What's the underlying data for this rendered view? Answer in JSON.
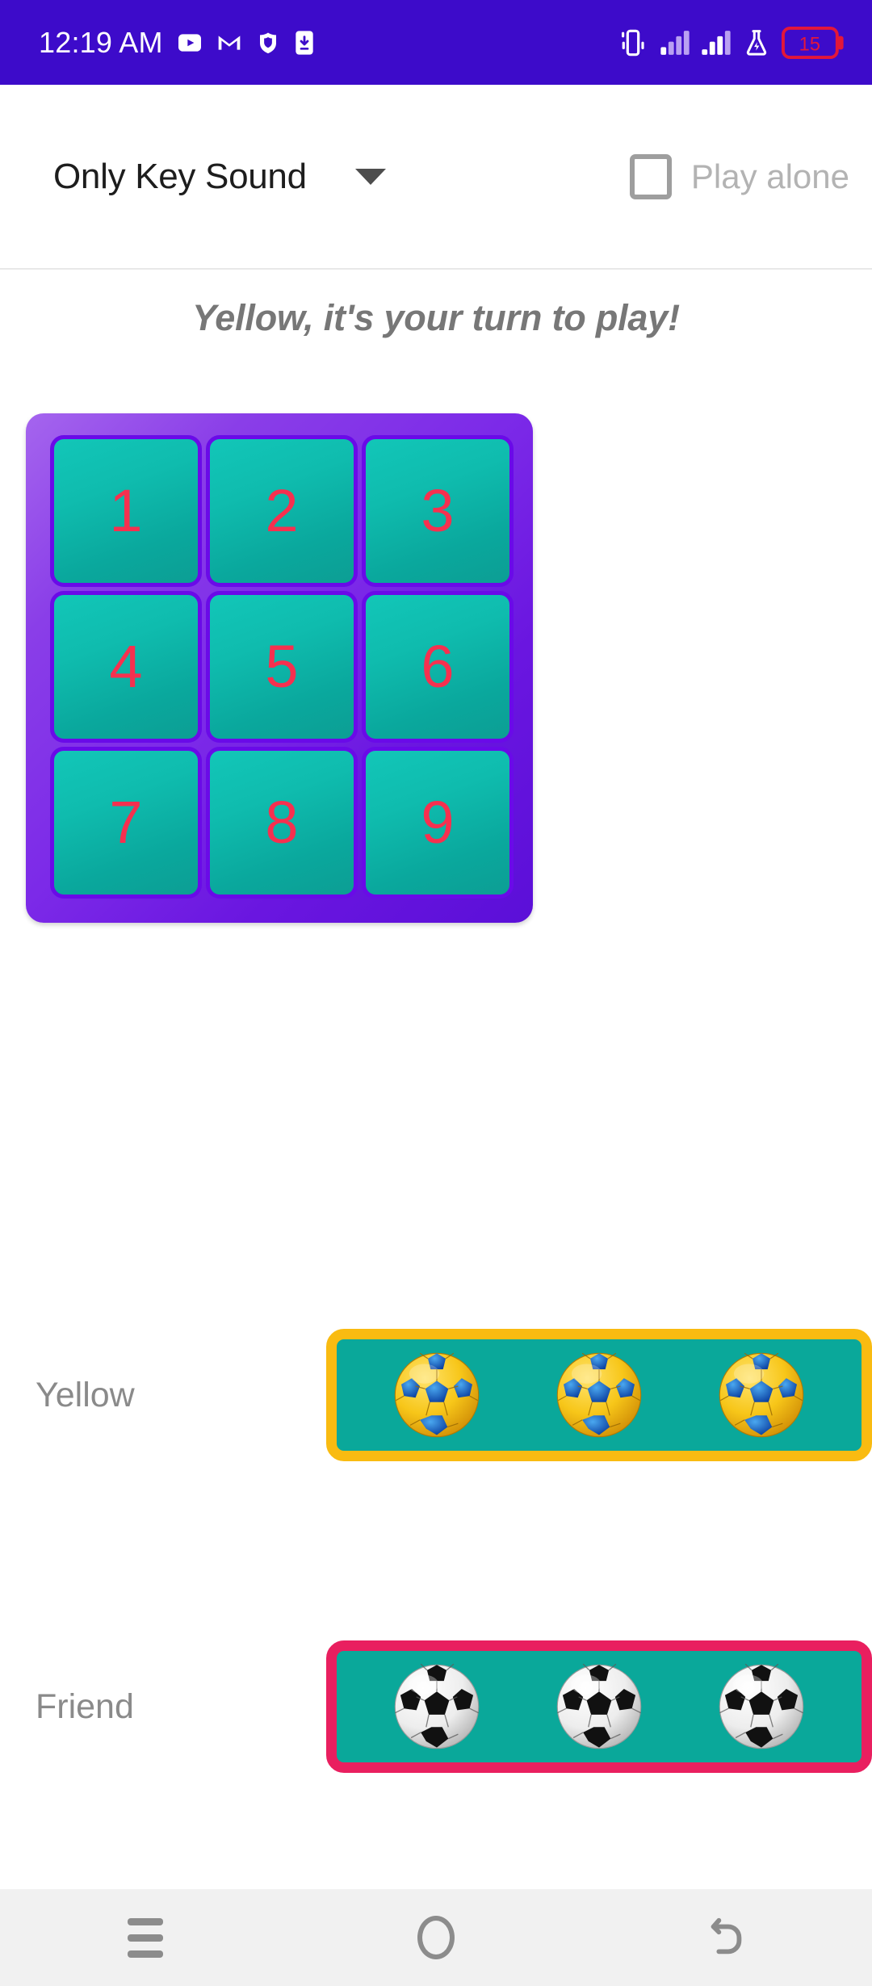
{
  "status_bar": {
    "time": "12:19 AM",
    "background_color": "#3d0bca",
    "left_icons": [
      "youtube-icon",
      "gmail-icon",
      "shield-icon",
      "download-icon"
    ],
    "right_icons": [
      "vibrate-icon",
      "signal-bars-1-icon",
      "signal-bars-2-icon",
      "battery-saver-flask-icon"
    ],
    "battery_percent": "15",
    "battery_color": "#e3173a"
  },
  "topbar": {
    "sound_mode": "Only Key Sound",
    "sound_mode_caret": "chevron-down-icon",
    "play_alone_label": "Play alone",
    "play_alone_checked": false
  },
  "turn_message": "Yellow, it's your turn to play!",
  "board": {
    "cells": [
      {
        "label": "1"
      },
      {
        "label": "2"
      },
      {
        "label": "3"
      },
      {
        "label": "4"
      },
      {
        "label": "5"
      },
      {
        "label": "6"
      },
      {
        "label": "7"
      },
      {
        "label": "8"
      },
      {
        "label": "9"
      }
    ],
    "cell_bg_color": "#0fbcae",
    "cell_border_color": "#6a0ae8",
    "number_color": "#f6304f",
    "frame_color": "#7c2ae8"
  },
  "players": [
    {
      "name": "Yellow",
      "accent_color": "#f9bb11",
      "panel_color": "#0aa89a",
      "ball_icon": "yellow-blue-soccer-ball-icon",
      "ball_count": 3
    },
    {
      "name": "Friend",
      "accent_color": "#e91f5f",
      "panel_color": "#0aa89a",
      "ball_icon": "black-white-soccer-ball-icon",
      "ball_count": 3
    }
  ],
  "navbar": {
    "recents_label": "recents-icon",
    "home_label": "home-icon",
    "back_label": "back-icon"
  }
}
